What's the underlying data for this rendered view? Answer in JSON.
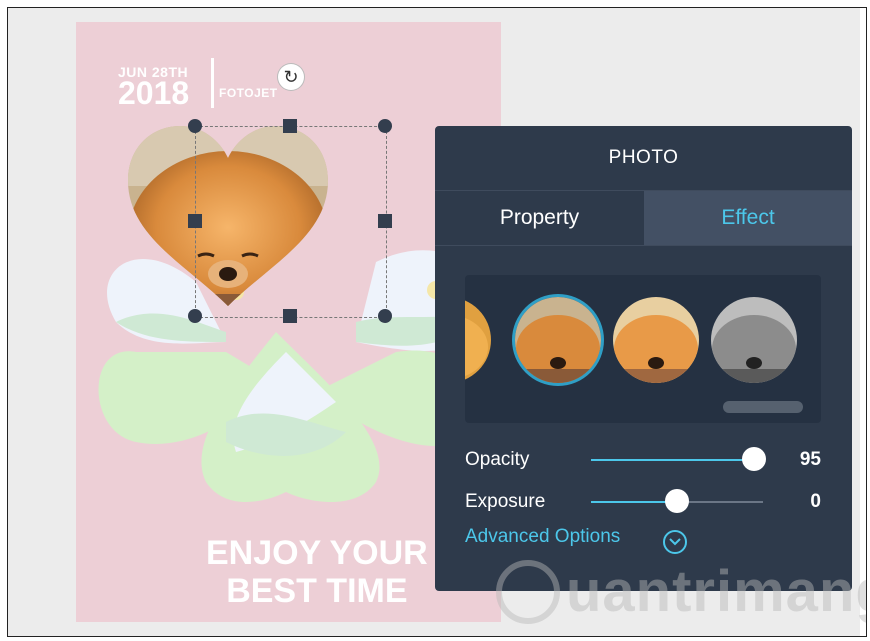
{
  "poster": {
    "date_month": "JUN 28TH",
    "date_year": "2018",
    "brand": "FOTOJET",
    "tagline_line1": "ENJOY YOUR",
    "tagline_line2": "BEST TIME"
  },
  "panel": {
    "title": "PHOTO",
    "tabs": [
      {
        "label": "Property",
        "active": false
      },
      {
        "label": "Effect",
        "active": true
      }
    ],
    "filters": [
      {
        "name": "warm-filter-partial",
        "selected": false
      },
      {
        "name": "original-filter",
        "selected": true
      },
      {
        "name": "vivid-filter",
        "selected": false
      },
      {
        "name": "grayscale-filter",
        "selected": false
      }
    ],
    "opacity": {
      "label": "Opacity",
      "value": "95",
      "level": 0.95
    },
    "exposure": {
      "label": "Exposure",
      "value": "0",
      "level": 0.5
    },
    "advanced_label": "Advanced Options",
    "advanced_icon": "chevron-down-circle-icon"
  },
  "watermark": {
    "text": "uantrimang"
  },
  "colors": {
    "panel_bg": "#2e3a4b",
    "accent": "#4cc7ea",
    "poster_bg": "#edcfd6"
  }
}
